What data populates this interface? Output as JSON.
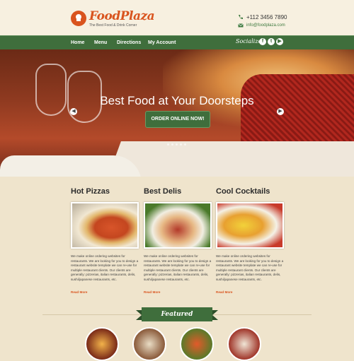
{
  "header": {
    "brand": "FoodPlaza",
    "tagline": "The Best Food & Drink Corner",
    "phone": "+112 3456 7890",
    "email": "info@foodplaza.com"
  },
  "nav": {
    "items": [
      "Home",
      "Menu",
      "Directions",
      "My Account"
    ],
    "socialize_label": "Socialize:",
    "social_icons": [
      "facebook-icon",
      "twitter-icon",
      "youtube-icon"
    ]
  },
  "hero": {
    "title": "Best Food at Your Doorsteps",
    "button_label": "ORDER ONLINE NOW!",
    "slides_count": 5
  },
  "sections": [
    {
      "title": "Hot Pizzas",
      "body": "We make online ordering websites for restaurants. We are looking for you to design a restaurant website template we can re-use for multiple restaurant clients. Our clients are generally: pizzerias, italian restaurants, delis, sushi/japanese restaurants, etc.",
      "link": "Read More"
    },
    {
      "title": "Best Delis",
      "body": "We make online ordering websites for restaurants. We are looking for you to design a restaurant website template we can re-use for multiple restaurant clients. Our clients are generally: pizzerias, italian restaurants, delis, sushi/japanese restaurants, etc.",
      "link": "Read More"
    },
    {
      "title": "Cool Cocktails",
      "body": "We make online ordering websites for restaurants. We are looking for you to design a restaurant website template we can re-use for multiple restaurant clients. Our clients are generally: pizzerias, italian restaurants, delis, sushi/japanese restaurants, etc.",
      "link": "Read More"
    }
  ],
  "featured": {
    "title": "Featured"
  },
  "colors": {
    "brand_orange": "#d9541e",
    "nav_green": "#3f6e3c",
    "background": "#efe4cc"
  }
}
